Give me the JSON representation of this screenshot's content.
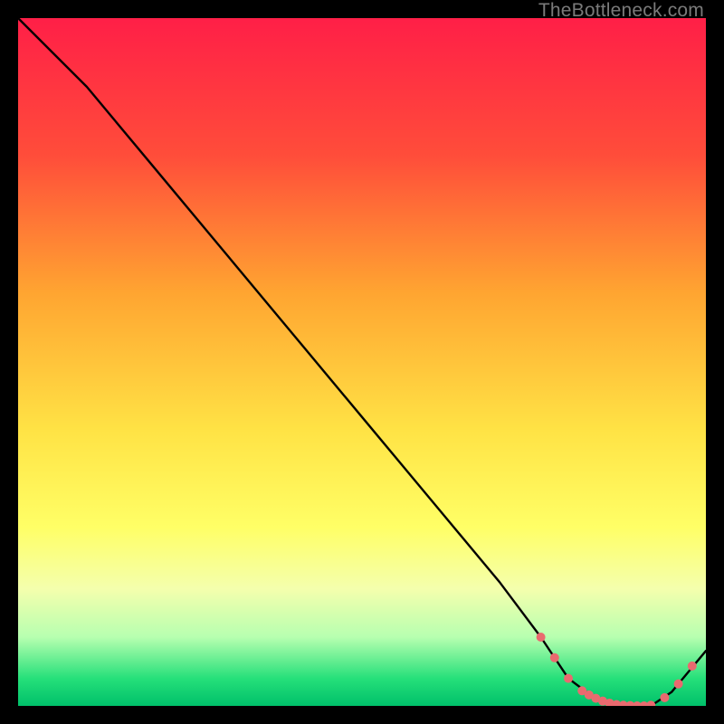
{
  "watermark": "TheBottleneck.com",
  "chart_data": {
    "type": "line",
    "title": "",
    "xlabel": "",
    "ylabel": "",
    "xlim": [
      0,
      100
    ],
    "ylim": [
      0,
      100
    ],
    "gradient_stops": [
      {
        "offset": 0,
        "color": "#ff1f47"
      },
      {
        "offset": 20,
        "color": "#ff4d3a"
      },
      {
        "offset": 40,
        "color": "#ffa531"
      },
      {
        "offset": 60,
        "color": "#ffe345"
      },
      {
        "offset": 74,
        "color": "#ffff66"
      },
      {
        "offset": 83,
        "color": "#f4ffad"
      },
      {
        "offset": 90,
        "color": "#b7ffb0"
      },
      {
        "offset": 96,
        "color": "#26e07a"
      },
      {
        "offset": 100,
        "color": "#00c06a"
      }
    ],
    "curve": {
      "x": [
        0,
        6,
        10,
        20,
        30,
        40,
        50,
        60,
        70,
        76,
        80,
        84,
        88,
        92,
        95,
        100
      ],
      "y": [
        100,
        94,
        90,
        78,
        66,
        54,
        42,
        30,
        18,
        10,
        4,
        1,
        0,
        0,
        2,
        8
      ]
    },
    "markers": {
      "x": [
        76,
        78,
        80,
        82,
        83,
        84,
        85,
        86,
        87,
        88,
        89,
        90,
        91,
        92,
        94,
        96,
        98
      ],
      "y": [
        10,
        7,
        4,
        2.2,
        1.6,
        1.1,
        0.7,
        0.4,
        0.2,
        0.1,
        0.05,
        0.0,
        0.0,
        0.1,
        1.2,
        3.2,
        5.8
      ],
      "color": "#e96a6f",
      "radius": 5
    }
  }
}
